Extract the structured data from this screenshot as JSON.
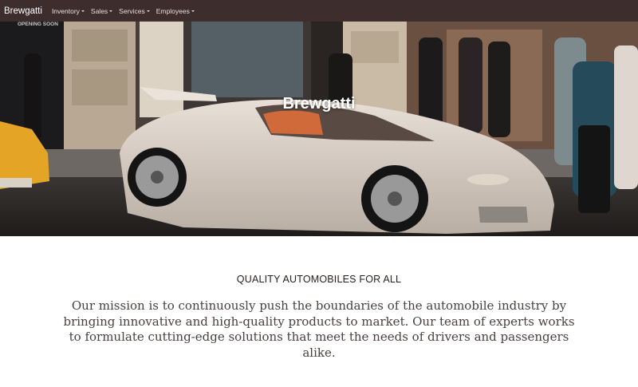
{
  "navbar": {
    "brand": "Brewgatti",
    "items": [
      {
        "label": "Inventory",
        "icon": "caret-down-icon"
      },
      {
        "label": "Sales",
        "icon": "caret-down-icon"
      },
      {
        "label": "Services",
        "icon": "caret-down-icon"
      },
      {
        "label": "Employees",
        "icon": "caret-down-icon"
      }
    ],
    "background": "#3d2d2d"
  },
  "hero": {
    "title": "Brewgatti",
    "storefront_sign": "OPENING SOON"
  },
  "content": {
    "tagline": "QUALITY AUTOMOBILES FOR ALL",
    "mission": "Our mission is to continuously push the boundaries of the automobile industry by bringing innovative and high-quality products to market. Our team of experts works to formulate cutting-edge solutions that meet the needs of drivers and passengers alike."
  }
}
